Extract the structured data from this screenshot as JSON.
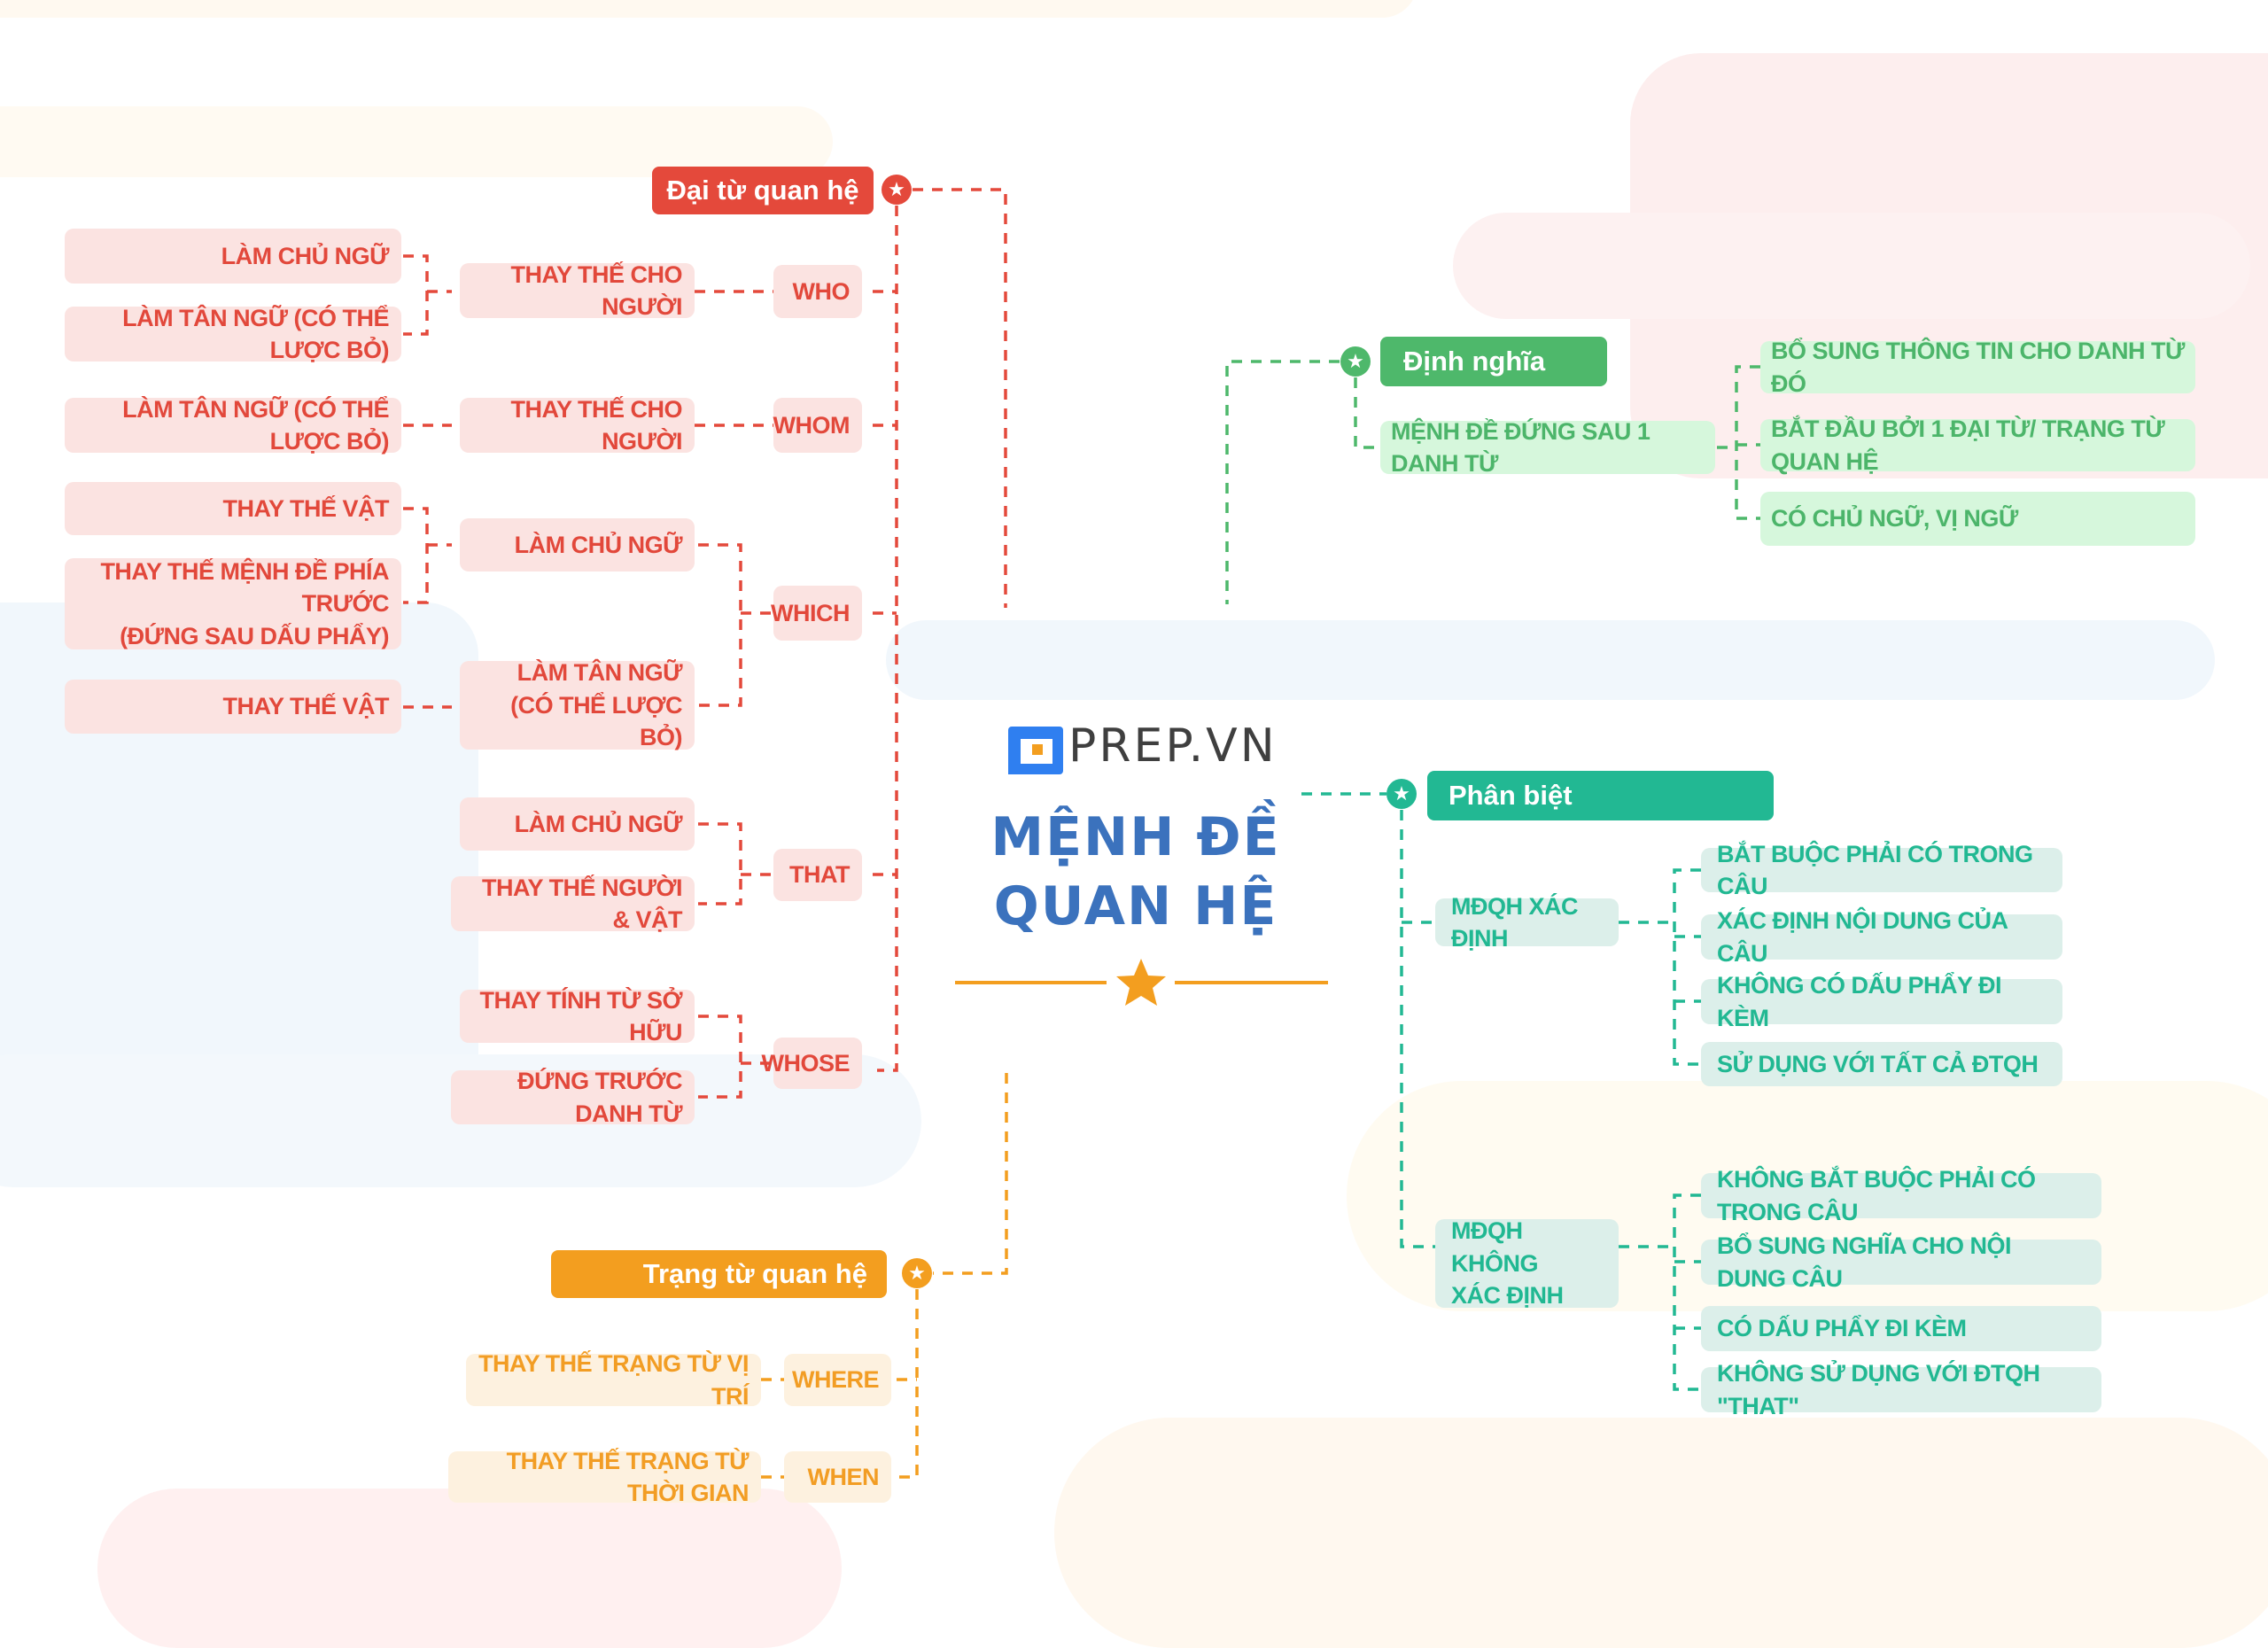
{
  "brand": {
    "name": "PREP.VN",
    "logo_icon": "prep-logo-icon"
  },
  "title": {
    "line1": "MỆNH ĐỀ",
    "line2": "QUAN HỆ"
  },
  "colors": {
    "red": "#e4493b",
    "red_light": "#fbe3e1",
    "orange": "#f39e1f",
    "orange_light": "#fdf1df",
    "green": "#4eb86b",
    "green_light": "#d6f7dc",
    "teal": "#22b893",
    "teal_light": "#dcefea",
    "title_blue": "#3b72bd",
    "logo_blue": "#2f7ff0"
  },
  "branches": {
    "pronouns": {
      "label": "Đại từ quan hệ",
      "groups": [
        {
          "pronoun": "WHO",
          "usage": "THAY THẾ CHO NGƯỜI",
          "details": [
            "LÀM CHỦ NGỮ",
            "LÀM TÂN NGỮ (CÓ THỂ LƯỢC BỎ)"
          ]
        },
        {
          "pronoun": "WHOM",
          "usage": "THAY THẾ CHO NGƯỜI",
          "details": [
            "LÀM TÂN NGỮ (CÓ THỂ LƯỢC BỎ)"
          ]
        },
        {
          "pronoun": "WHICH",
          "subs": [
            {
              "usage": "LÀM CHỦ NGỮ",
              "details": [
                "THAY THẾ VẬT",
                "THAY THẾ MỆNH ĐỀ PHÍA TRƯỚC\n(ĐỨNG SAU DẤU PHẨY)"
              ]
            },
            {
              "usage": "LÀM TÂN NGỮ\n(CÓ THỂ LƯỢC BỎ)",
              "details": [
                "THAY THẾ VẬT"
              ]
            }
          ]
        },
        {
          "pronoun": "THAT",
          "details": [
            "LÀM CHỦ NGỮ",
            "THAY THẾ NGƯỜI & VẬT"
          ]
        },
        {
          "pronoun": "WHOSE",
          "details": [
            "THAY TÍNH TỪ SỞ HỮU",
            "ĐỨNG TRƯỚC DANH TỪ"
          ]
        }
      ]
    },
    "adverbs": {
      "label": "Trạng từ quan hệ",
      "items": [
        {
          "adverb": "WHERE",
          "usage": "THAY THẾ TRẠNG TỪ VỊ TRÍ"
        },
        {
          "adverb": "WHEN",
          "usage": "THAY THẾ TRẠNG TỪ THỜI GIAN"
        }
      ]
    },
    "definition": {
      "label": "Định nghĩa",
      "main": "MỆNH ĐỀ ĐỨNG SAU 1 DANH TỪ",
      "details": [
        "BỔ SUNG THÔNG TIN CHO DANH TỪ ĐÓ",
        "BẮT ĐẦU BỞI 1 ĐẠI TỪ/ TRẠNG TỪ QUAN HỆ",
        "CÓ CHỦ NGỮ, VỊ NGỮ"
      ]
    },
    "distinction": {
      "label": "Phân biệt",
      "types": [
        {
          "name": "MĐQH XÁC ĐỊNH",
          "details": [
            "BẮT BUỘC PHẢI CÓ TRONG CÂU",
            "XÁC ĐỊNH NỘI DUNG CỦA CÂU",
            "KHÔNG CÓ DẤU PHẨY ĐI KÈM",
            "SỬ DỤNG VỚI TẤT CẢ ĐTQH"
          ]
        },
        {
          "name": "MĐQH KHÔNG\nXÁC ĐỊNH",
          "details": [
            "KHÔNG BẮT BUỘC PHẢI CÓ TRONG CÂU",
            "BỔ SUNG NGHĨA CHO NỘI DUNG CÂU",
            "CÓ DẤU PHẨY ĐI KÈM",
            "KHÔNG SỬ DỤNG VỚI ĐTQH \"THAT\""
          ]
        }
      ]
    }
  }
}
